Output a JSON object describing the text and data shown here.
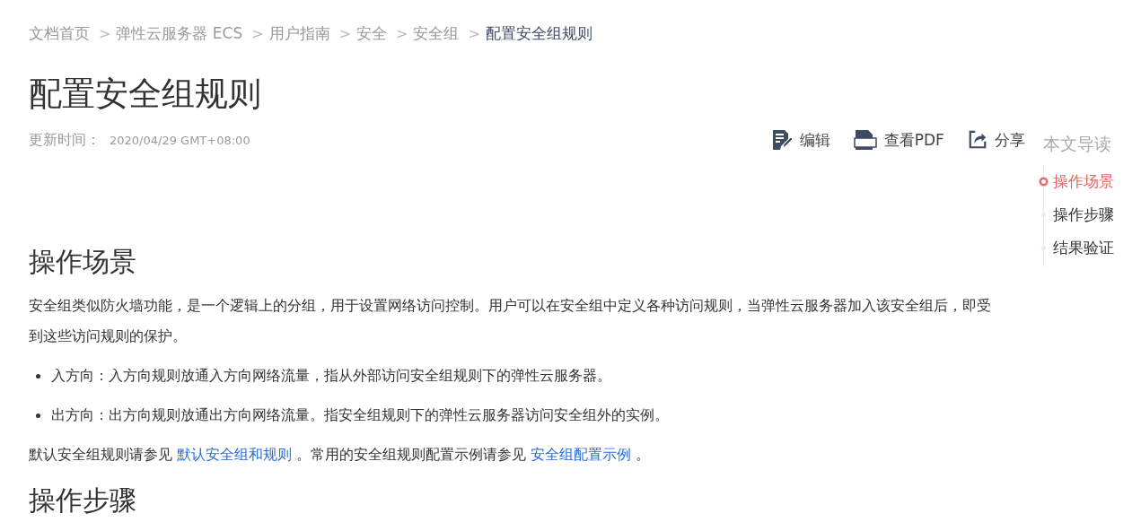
{
  "breadcrumb": [
    {
      "label": "文档首页",
      "current": false
    },
    {
      "separator": ">",
      "label": "弹性云服务器 ECS",
      "current": false
    },
    {
      "separator": ">",
      "label": "用户指南",
      "current": false
    },
    {
      "separator": ">",
      "label": "安全",
      "current": false
    },
    {
      "separator": ">",
      "label": "安全组",
      "current": false
    },
    {
      "separator": ">",
      "label": "配置安全组规则",
      "current": true
    }
  ],
  "title": "配置安全组规则",
  "update": {
    "label": "更新时间：",
    "value": "2020/04/29 GMT+08:00"
  },
  "actions": [
    {
      "kind": "edit",
      "label": "编辑"
    },
    {
      "kind": "pdf",
      "label": "查看PDF"
    },
    {
      "kind": "share",
      "label": "分享"
    }
  ],
  "toc": {
    "title": "本文导读",
    "items": [
      {
        "label": "操作场景",
        "selected": true
      },
      {
        "label": "操作步骤",
        "selected": false
      },
      {
        "label": "结果验证",
        "selected": false
      }
    ]
  },
  "sections": [
    {
      "heading": "操作场景",
      "blocks": [
        {
          "kind": "paragraph",
          "segments": [
            {
              "kind": "text",
              "text": "安全组类似防火墙功能，是一个逻辑上的分组，用于设置网络访问控制。用户可以在安全组中定义各种访问规则，当弹性云服务器加入该安全组后，即受到这些访问规则的保护。"
            }
          ]
        },
        {
          "kind": "bullet",
          "segments": [
            {
              "kind": "text",
              "text": "入方向：入方向规则放通入方向网络流量，指从外部访问安全组规则下的弹性云服务器。"
            }
          ]
        },
        {
          "kind": "bullet",
          "segments": [
            {
              "kind": "text",
              "text": "出方向：出方向规则放通出方向网络流量。指安全组规则下的弹性云服务器访问安全组外的实例。"
            }
          ]
        },
        {
          "kind": "paragraph",
          "segments": [
            {
              "kind": "text",
              "text": "默认安全组规则请参见 "
            },
            {
              "kind": "link",
              "text": "默认安全组和规则"
            },
            {
              "kind": "text",
              "text": " 。常用的安全组规则配置示例请参见 "
            },
            {
              "kind": "link",
              "text": "安全组配置示例"
            },
            {
              "kind": "text",
              "text": " 。"
            }
          ]
        }
      ]
    },
    {
      "heading": "操作步骤"
    }
  ]
}
